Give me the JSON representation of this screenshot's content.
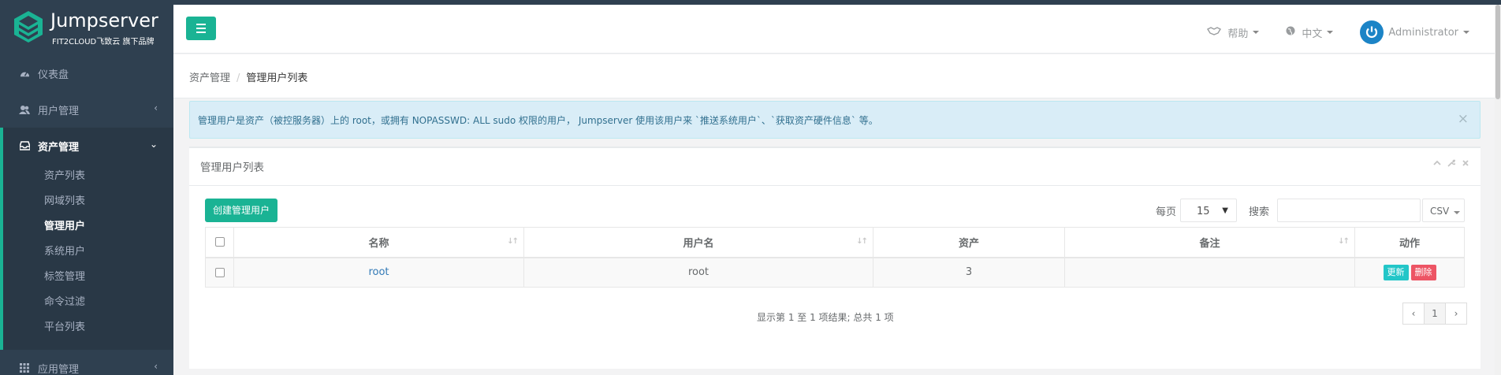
{
  "brand": {
    "name": "Jumpserver",
    "sub": "FIT2CLOUD飞致云 旗下品牌"
  },
  "sidebar": {
    "items": [
      {
        "label": "仪表盘",
        "icon": "dashboard-icon"
      },
      {
        "label": "用户管理",
        "icon": "users-icon"
      },
      {
        "label": "资产管理",
        "icon": "inbox-icon"
      },
      {
        "label": "应用管理",
        "icon": "grid-icon"
      }
    ],
    "asset_children": [
      "资产列表",
      "网域列表",
      "管理用户",
      "系统用户",
      "标签管理",
      "命令过滤",
      "平台列表"
    ]
  },
  "topbar": {
    "help": "帮助",
    "lang": "中文",
    "user": "Administrator"
  },
  "breadcrumb": {
    "root": "资产管理",
    "sep": "/",
    "current": "管理用户列表"
  },
  "alert": {
    "text": "管理用户是资产（被控服务器）上的 root，或拥有 NOPASSWD: ALL sudo 权限的用户， Jumpserver 使用该用户来 `推送系统用户`、`获取资产硬件信息` 等。",
    "close": "×"
  },
  "panel": {
    "title": "管理用户列表",
    "create_button": "创建管理用户",
    "per_page_label": "每页",
    "per_page_value": "15",
    "search_label": "搜索",
    "search_value": "",
    "export": "CSV"
  },
  "table": {
    "headers": [
      "名称",
      "用户名",
      "资产",
      "备注",
      "动作"
    ],
    "rows": [
      {
        "name": "root",
        "username": "root",
        "assets": "3",
        "comment": "",
        "update": "更新",
        "delete": "删除"
      }
    ]
  },
  "pagination": {
    "info": "显示第 1 至 1 项结果; 总共 1 项",
    "prev": "‹",
    "page": "1",
    "next": "›"
  },
  "colors": {
    "sidebar": "#2f4050",
    "primary": "#1ab394",
    "info": "#23c6c8",
    "danger": "#ed5565",
    "alert_bg": "#d9edf7"
  }
}
